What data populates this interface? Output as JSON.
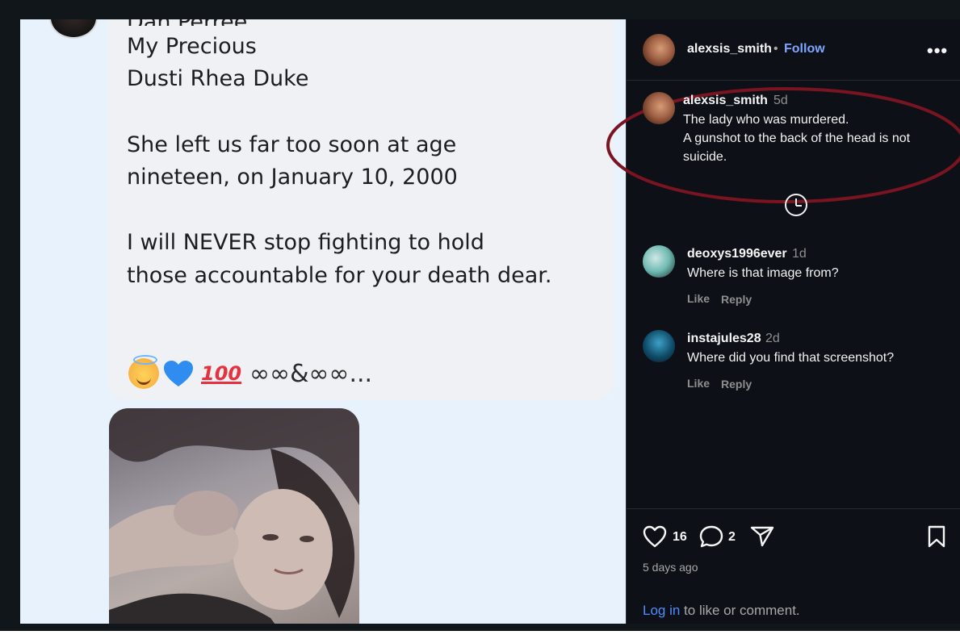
{
  "post": {
    "partial_name": "Dan Perree",
    "lines": [
      "My Precious",
      "Dusti Rhea Duke",
      "She left us far too soon at age",
      "nineteen, on January 10, 2000",
      "I will NEVER stop fighting to hold",
      "those accountable for your death dear."
    ],
    "emoji_tail": "∞∞&∞∞...",
    "hundred": "100"
  },
  "header": {
    "username": "alexsis_smith",
    "separator": "•",
    "follow_label": "Follow",
    "more_label": "•••"
  },
  "caption": {
    "username": "alexsis_smith",
    "time": "5d",
    "lines": [
      "The lady who was murdered.",
      "A gunshot to the back of the head is not",
      "suicide."
    ]
  },
  "comments": [
    {
      "username": "deoxys1996ever",
      "time": "1d",
      "text": "Where is that image from?",
      "like_label": "Like",
      "reply_label": "Reply"
    },
    {
      "username": "instajules28",
      "time": "2d",
      "text": "Where did you find that screenshot?",
      "like_label": "Like",
      "reply_label": "Reply"
    }
  ],
  "actions": {
    "like_count": "16",
    "comment_count": "2",
    "posted_ago": "5 days ago",
    "login_link": "Log in",
    "login_rest": " to like or comment."
  },
  "colors": {
    "annotation_ellipse": "#7a1420",
    "follow": "#7fa6ff",
    "link": "#4f8cff"
  }
}
